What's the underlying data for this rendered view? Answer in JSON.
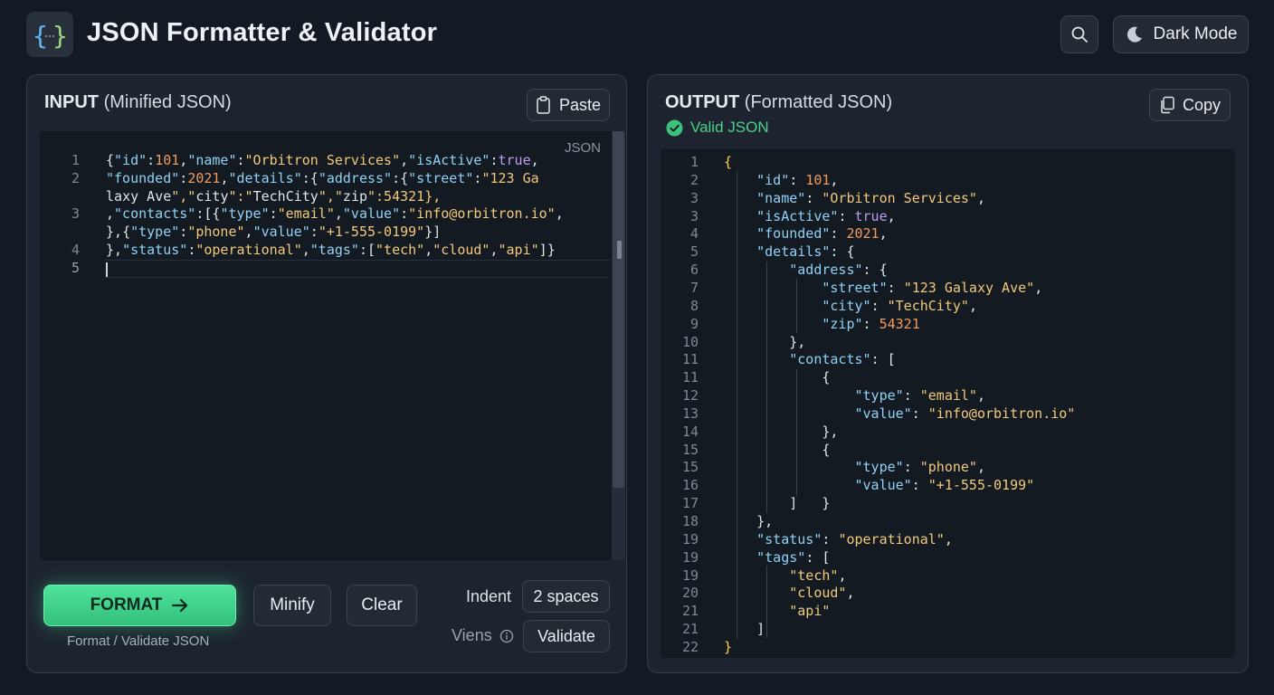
{
  "app": {
    "title": "JSON Formatter & Validator"
  },
  "header": {
    "dark_mode_label": "Dark Mode",
    "search_icon": "search-icon",
    "moon_icon": "moon-icon"
  },
  "input_panel": {
    "title_bold": "INPUT",
    "title_rest": "(Minified JSON)",
    "paste_label": "Paste",
    "language_tag": "JSON",
    "lines": [
      {
        "num": "1",
        "text": "{\"id\":101,\"name\":\"Orbitron Services\",\"isActive\":true,"
      },
      {
        "num": "2",
        "text": "\"founded\":2021,\"details\":{\"address\":{\"street\":\"123 Ga"
      },
      {
        "num": "",
        "text": "laxy Ave\",\"city\":\"TechCity\",\"zip\":54321},"
      },
      {
        "num": "3",
        "text": ",\"contacts\":[{\"type\":\"email\",\"value\":\"info@orbitron.io\","
      },
      {
        "num": "",
        "text": "},{\"type\":\"phone\",\"value\":\"+1-555-0199\"}]"
      },
      {
        "num": "4",
        "text": "},\"status\":\"operational\",\"tags\":[\"tech\",\"cloud\",\"api\"]}"
      },
      {
        "num": "5",
        "text": ""
      }
    ],
    "format_label": "FORMAT",
    "format_sub": "Format / Validate JSON",
    "minify_label": "Minify",
    "clear_label": "Clear",
    "indent_label": "Indent",
    "indent_value": "2 spaces",
    "views_label": "Viens",
    "validate_label": "Validate"
  },
  "output_panel": {
    "title_bold": "OUTPUT",
    "title_rest": "(Formatted JSON)",
    "copy_label": "Copy",
    "valid_label": "Valid JSON",
    "lines": [
      {
        "num": "1",
        "text": "{"
      },
      {
        "num": "2",
        "text": "    \"id\": 101,"
      },
      {
        "num": "3",
        "text": "    \"name\": \"Orbitron Services\","
      },
      {
        "num": "3",
        "text": "    \"isActive\": true,"
      },
      {
        "num": "4",
        "text": "    \"founded\": 2021,"
      },
      {
        "num": "5",
        "text": "    \"details\": {"
      },
      {
        "num": "6",
        "text": "        \"address\": {"
      },
      {
        "num": "7",
        "text": "            \"street\": \"123 Galaxy Ave\","
      },
      {
        "num": "8",
        "text": "            \"city\": \"TechCity\","
      },
      {
        "num": "9",
        "text": "            \"zip\": 54321"
      },
      {
        "num": "10",
        "text": "        },"
      },
      {
        "num": "11",
        "text": "        \"contacts\": ["
      },
      {
        "num": "11",
        "text": "            {"
      },
      {
        "num": "12",
        "text": "                \"type\": \"email\","
      },
      {
        "num": "13",
        "text": "                \"value\": \"info@orbitron.io\""
      },
      {
        "num": "14",
        "text": "            },"
      },
      {
        "num": "15",
        "text": "            {"
      },
      {
        "num": "15",
        "text": "                \"type\": \"phone\","
      },
      {
        "num": "16",
        "text": "                \"value\": \"+1-555-0199\""
      },
      {
        "num": "17",
        "text": "        ]   }"
      },
      {
        "num": "18",
        "text": "    },"
      },
      {
        "num": "19",
        "text": "    \"status\": \"operational\","
      },
      {
        "num": "19",
        "text": "    \"tags\": ["
      },
      {
        "num": "19",
        "text": "        \"tech\","
      },
      {
        "num": "20",
        "text": "        \"cloud\","
      },
      {
        "num": "21",
        "text": "        \"api\""
      },
      {
        "num": "21",
        "text": "    ]"
      },
      {
        "num": "22",
        "text": "}"
      }
    ]
  },
  "colors": {
    "accent_green": "#4bd08a",
    "key": "#8fd2f5",
    "string": "#f2c97b",
    "number": "#f29a5a",
    "keyword": "#bb9cf0",
    "brace": "#ffd24a"
  }
}
